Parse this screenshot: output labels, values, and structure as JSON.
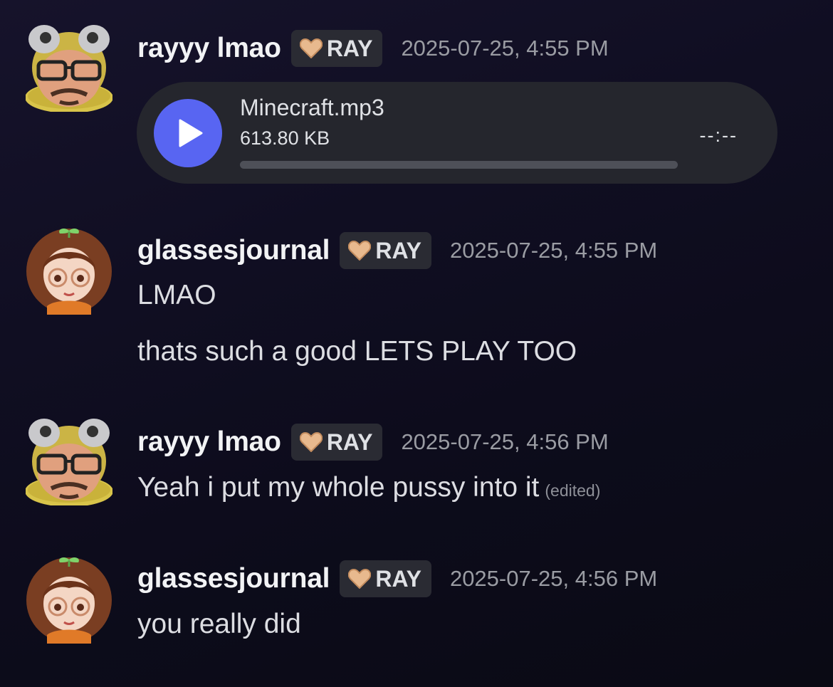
{
  "messages": [
    {
      "author": "rayyy lmao",
      "tag": "RAY",
      "timestamp": "2025-07-25, 4:55 PM",
      "attachment": {
        "file_name": "Minecraft.mp3",
        "file_size": "613.80 KB",
        "duration": "--:--",
        "progress": 0,
        "icon": "play-icon"
      }
    },
    {
      "author": "glassesjournal",
      "tag": "RAY",
      "timestamp": "2025-07-25, 4:55 PM",
      "lines": [
        "LMAO",
        "thats such a good LETS PLAY TOO"
      ]
    },
    {
      "author": "rayyy lmao",
      "tag": "RAY",
      "timestamp": "2025-07-25, 4:56 PM",
      "lines": [
        "Yeah i put my whole pussy into it"
      ],
      "edited_label": "(edited)"
    },
    {
      "author": "glassesjournal",
      "tag": "RAY",
      "timestamp": "2025-07-25, 4:56 PM",
      "lines": [
        "you really did"
      ]
    }
  ],
  "colors": {
    "accent": "#5865f2",
    "tag_heart": "#e8b98e",
    "background": "#100e22"
  },
  "icons": {
    "tag": "heart-icon",
    "play": "play-icon"
  }
}
